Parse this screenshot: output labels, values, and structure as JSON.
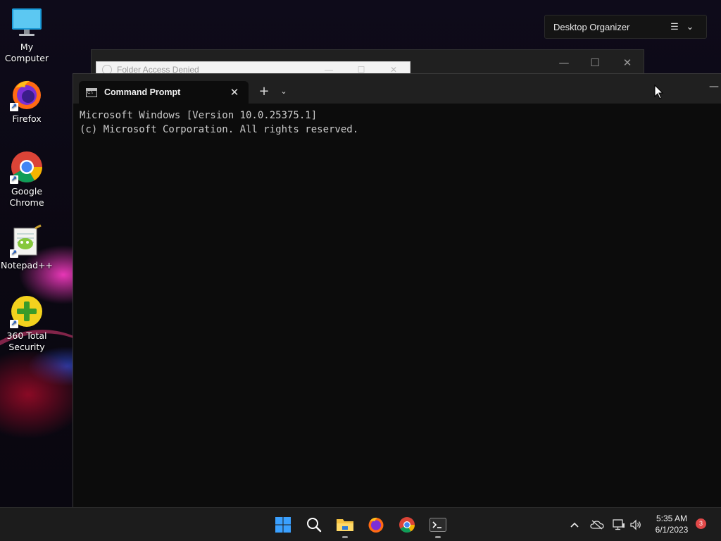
{
  "desktop": {
    "icons": [
      {
        "label": "My Computer",
        "icon": "monitor-icon"
      },
      {
        "label": "Firefox",
        "icon": "firefox-icon"
      },
      {
        "label": "Google Chrome",
        "icon": "chrome-icon"
      },
      {
        "label": "Notepad++",
        "icon": "notepad-plus-plus-icon"
      },
      {
        "label": "360 Total Security",
        "icon": "shield-plus-icon"
      }
    ]
  },
  "organizer": {
    "title": "Desktop Organizer",
    "menu_icon": "hamburger-icon",
    "collapse_icon": "chevron-down-icon"
  },
  "background_window": {
    "dialog_title": "Folder Access Denied"
  },
  "terminal": {
    "tab_title": "Command Prompt",
    "tab_icon": "cmd-icon",
    "new_tab_label": "+",
    "lines": [
      "Microsoft Windows [Version 10.0.25375.1]",
      "(c) Microsoft Corporation. All rights reserved."
    ]
  },
  "taskbar": {
    "apps": [
      "start-icon",
      "search-icon",
      "file-explorer-icon",
      "firefox-icon",
      "chrome-icon",
      "terminal-icon"
    ],
    "tray": [
      "chevron-up-icon",
      "onedrive-offline-icon",
      "network-icon",
      "volume-icon"
    ],
    "time": "5:35 AM",
    "date": "6/1/2023",
    "notification_count": "3"
  },
  "colors": {
    "terminal_bg": "#0c0c0c",
    "terminal_text": "#cccccc",
    "titlebar": "#202020",
    "taskbar": "#1c1c1c",
    "badge": "#e04848"
  }
}
